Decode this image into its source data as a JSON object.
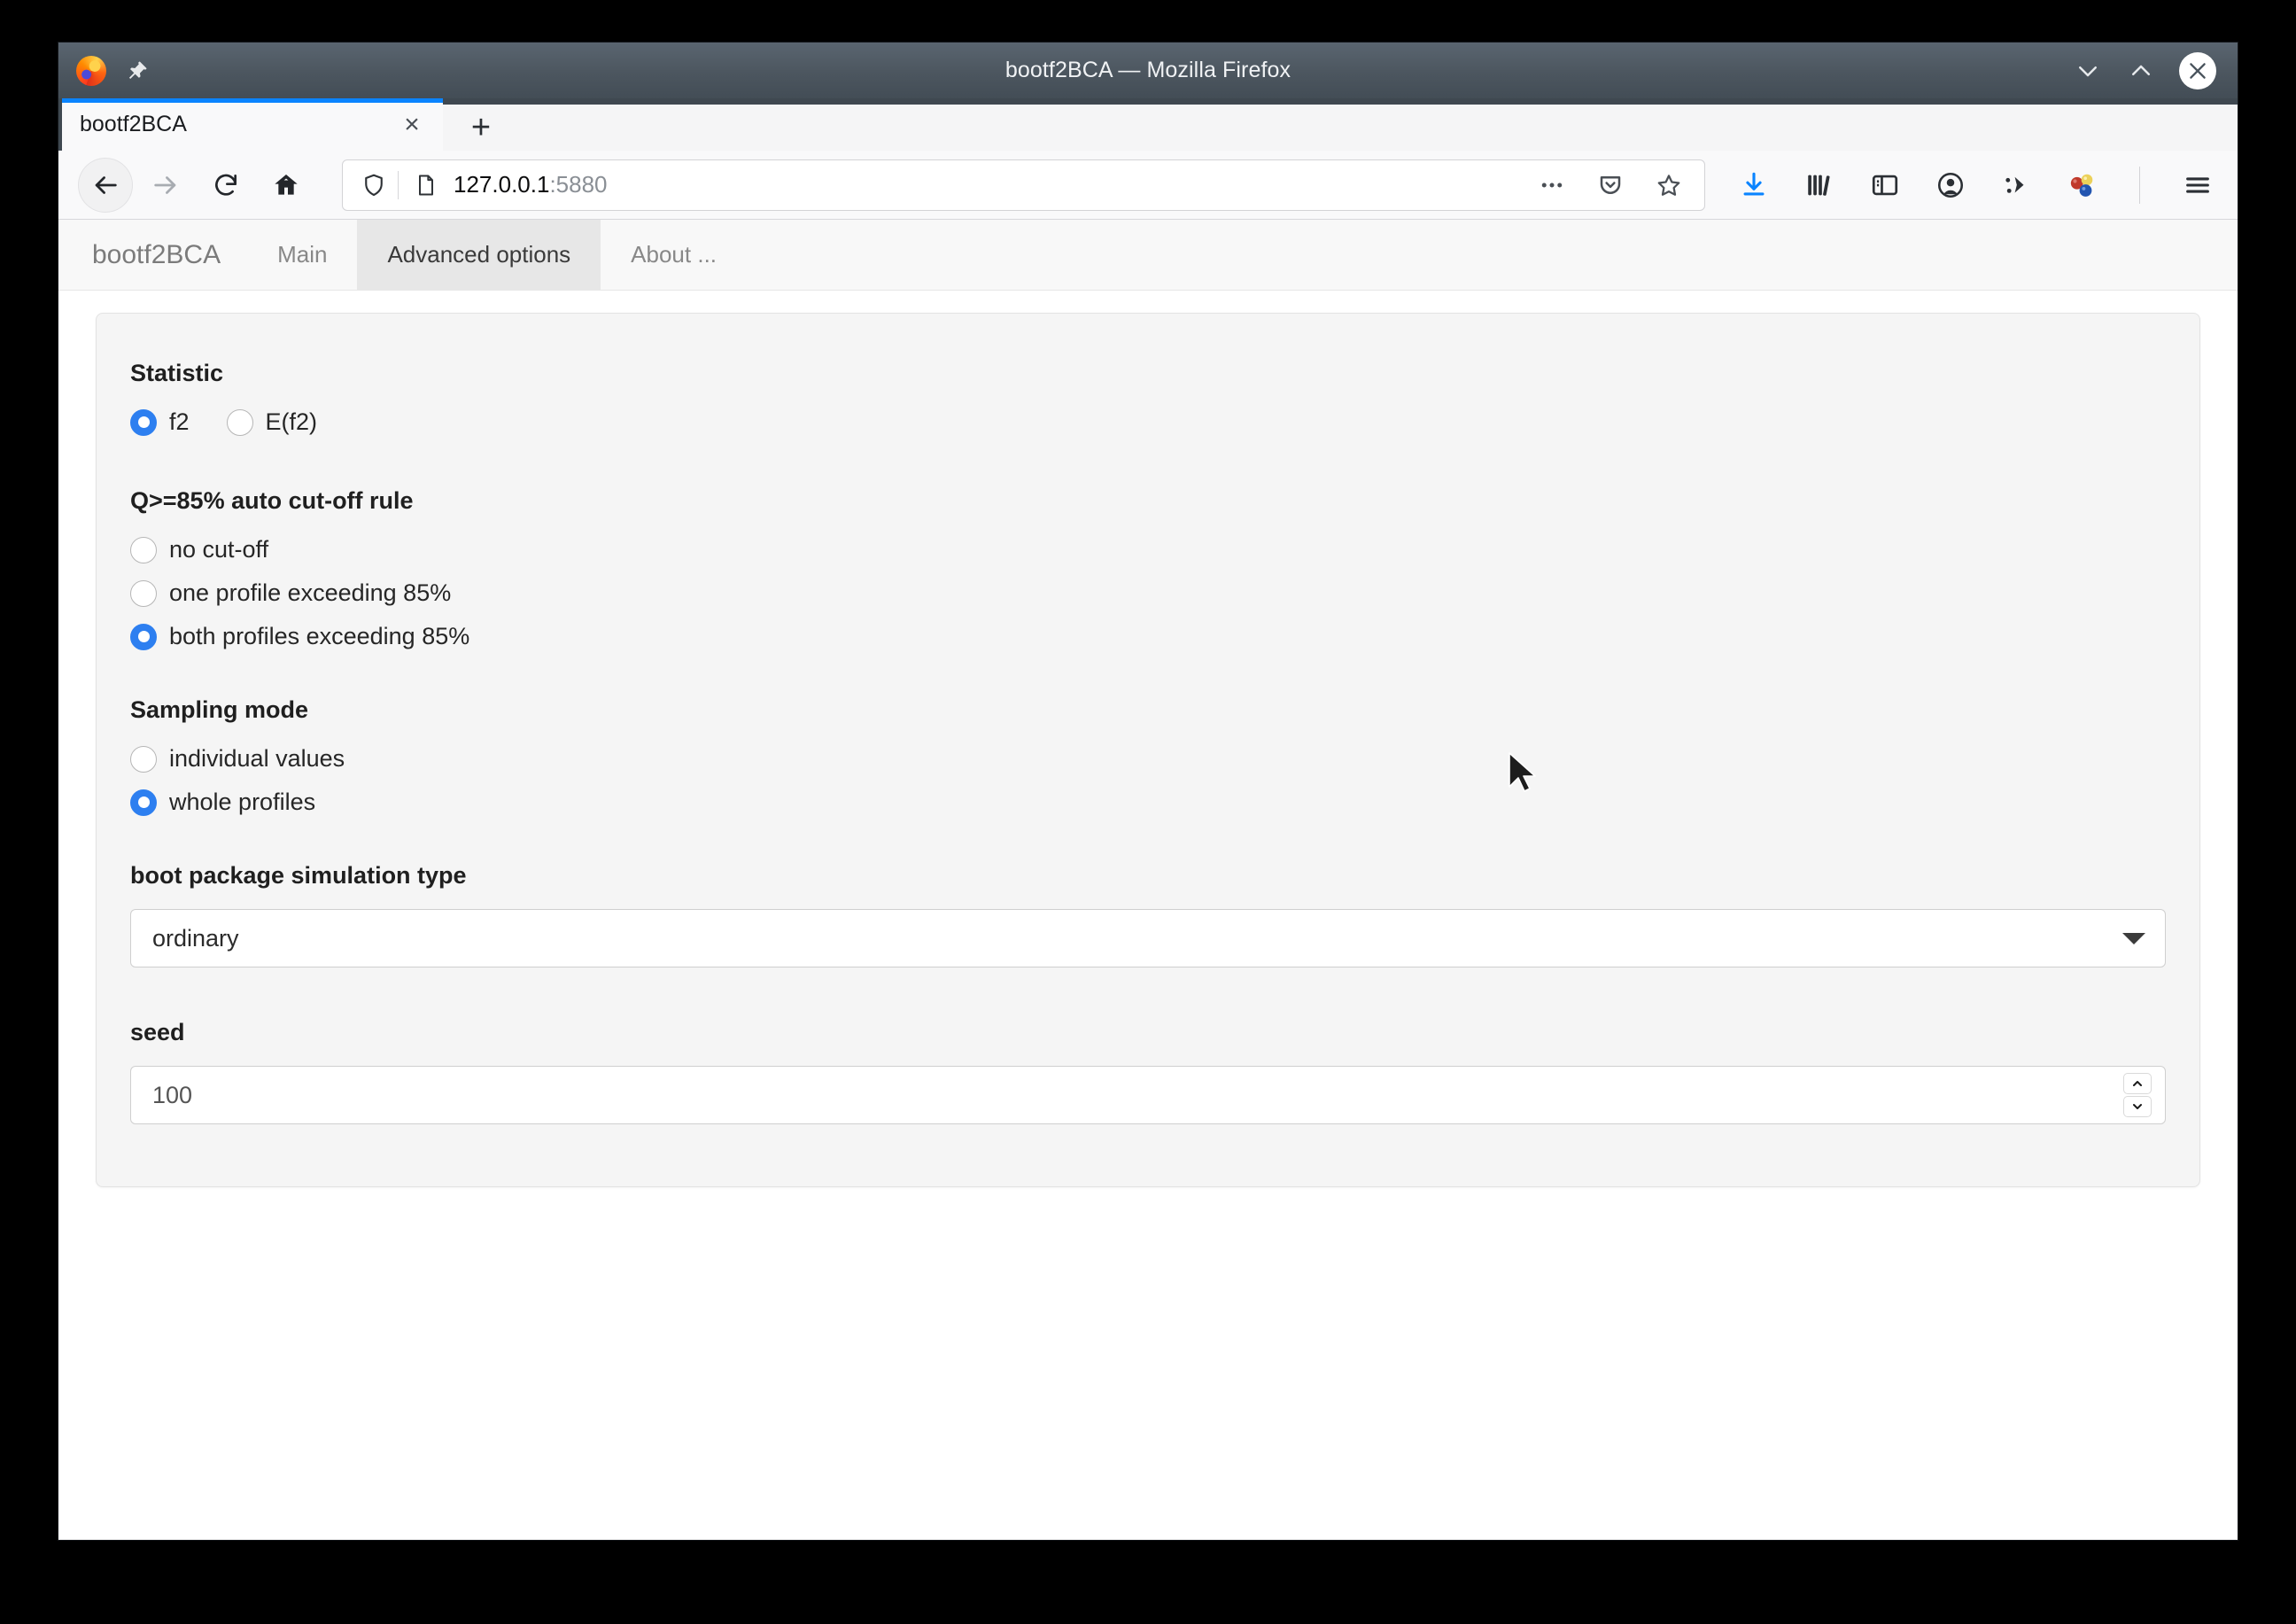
{
  "window": {
    "title": "bootf2BCA — Mozilla Firefox",
    "minimize_label": "Minimize",
    "maximize_label": "Maximize",
    "close_label": "Close"
  },
  "browser": {
    "tab": {
      "title": "bootf2BCA",
      "close_label": "×"
    },
    "new_tab_label": "+",
    "url": {
      "host": "127.0.0.1",
      "port": ":5880",
      "full": "127.0.0.1:5880"
    },
    "icons": {
      "back": "back-arrow-icon",
      "forward": "forward-arrow-icon",
      "reload": "reload-icon",
      "home": "home-icon",
      "shield": "tracking-protection-shield-icon",
      "page": "page-info-icon",
      "more": "page-actions-ellipsis-icon",
      "pocket": "save-to-pocket-icon",
      "bookmark": "bookmark-star-icon",
      "downloads": "downloads-icon",
      "library": "library-icon",
      "sidebar": "sidebar-icon",
      "account": "account-icon",
      "extension": "extension-icon",
      "spheres": "colored-spheres-icon",
      "menu": "hamburger-menu-icon",
      "firefox": "firefox-logo-icon",
      "pin": "pin-icon"
    }
  },
  "app": {
    "brand": "bootf2BCA",
    "tabs": [
      {
        "label": "Main",
        "active": false
      },
      {
        "label": "Advanced options",
        "active": true
      },
      {
        "label": "About ...",
        "active": false
      }
    ]
  },
  "form": {
    "statistic": {
      "title": "Statistic",
      "options": [
        {
          "label": "f2",
          "checked": true
        },
        {
          "label": "E(f2)",
          "checked": false
        }
      ]
    },
    "cutoff": {
      "title": "Q>=85% auto cut-off rule",
      "options": [
        {
          "label": "no cut-off",
          "checked": false
        },
        {
          "label": "one profile exceeding 85%",
          "checked": false
        },
        {
          "label": "both profiles exceeding 85%",
          "checked": true
        }
      ]
    },
    "sampling": {
      "title": "Sampling mode",
      "options": [
        {
          "label": "individual values",
          "checked": false
        },
        {
          "label": "whole profiles",
          "checked": true
        }
      ]
    },
    "simulation_type": {
      "label": "boot package simulation type",
      "value": "ordinary"
    },
    "seed": {
      "label": "seed",
      "value": "100",
      "increment_label": "Increment",
      "decrement_label": "Decrement"
    }
  },
  "colors": {
    "accent_blue": "#2d7ff0",
    "tab_indicator": "#0a84ff",
    "titlebar": "#4c565f",
    "card_bg": "#f5f5f5",
    "active_nav_tab": "#e7e7e7"
  }
}
